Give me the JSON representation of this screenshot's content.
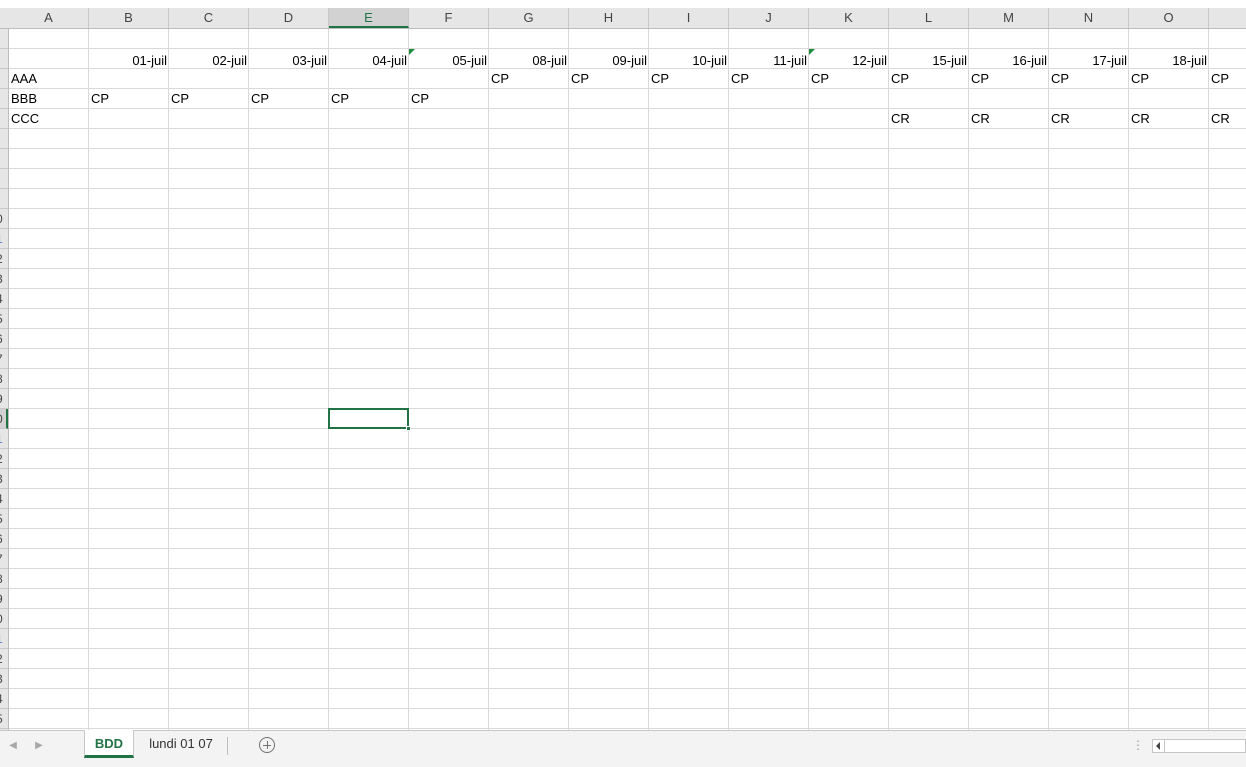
{
  "columns": [
    "A",
    "B",
    "C",
    "D",
    "E",
    "F",
    "G",
    "H",
    "I",
    "J",
    "K",
    "L",
    "M",
    "N",
    "O"
  ],
  "active_column": "E",
  "row_numbers": [
    "",
    "",
    "",
    "",
    "",
    "",
    "",
    "",
    "",
    "0",
    "1",
    "2",
    "3",
    "4",
    "5",
    "6",
    "7",
    "8",
    "9",
    "0",
    "1",
    "2",
    "3",
    "4",
    "5",
    "6",
    "7",
    "8",
    "9",
    "0",
    "1",
    "2",
    "3",
    "4",
    "5"
  ],
  "header_row": {
    "dates": [
      "01-juil",
      "02-juil",
      "03-juil",
      "04-juil",
      "05-juil",
      "08-juil",
      "09-juil",
      "10-juil",
      "11-juil",
      "12-juil",
      "15-juil",
      "16-juil",
      "17-juil",
      "18-juil"
    ]
  },
  "rows": [
    {
      "name": "AAA",
      "cells": [
        "",
        "",
        "",
        "",
        "",
        "CP",
        "CP",
        "CP",
        "CP",
        "CP",
        "CP",
        "CP",
        "CP",
        "CP",
        "CP"
      ]
    },
    {
      "name": "BBB",
      "cells": [
        "CP",
        "CP",
        "CP",
        "CP",
        "CP",
        "",
        "",
        "",
        "",
        "",
        "",
        "",
        "",
        "",
        ""
      ]
    },
    {
      "name": "CCC",
      "cells": [
        "",
        "",
        "",
        "",
        "",
        "",
        "",
        "",
        "",
        "",
        "CR",
        "CR",
        "CR",
        "CR",
        "CR"
      ]
    }
  ],
  "sheet_tabs": [
    {
      "label": "BDD",
      "active": true
    },
    {
      "label": "lundi 01 07",
      "active": false
    }
  ],
  "colors": {
    "accent": "#217346",
    "gridline": "#d9d9d9",
    "comment_marker": "#1e8c3a"
  },
  "icons": {
    "tab_prev": "chevron-left-icon",
    "tab_next": "chevron-right-icon",
    "add_sheet": "plus-circle-icon",
    "scroll_left": "triangle-left-icon"
  }
}
